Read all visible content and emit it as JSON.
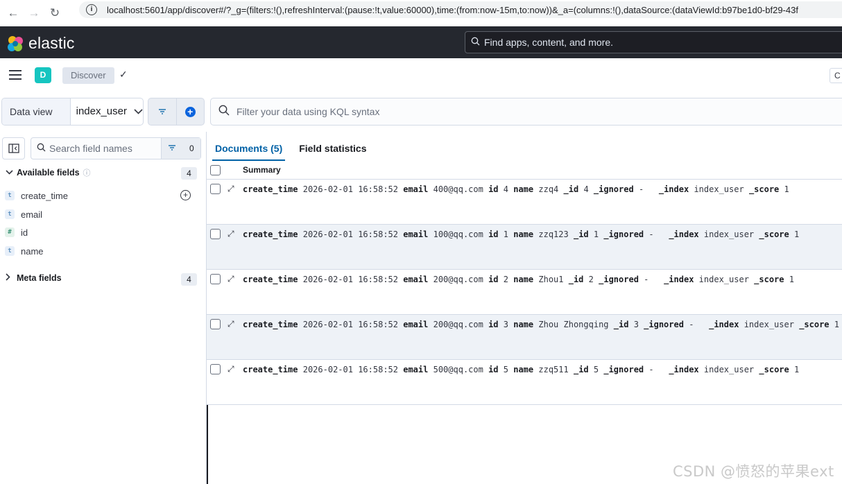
{
  "browser": {
    "url": "localhost:5601/app/discover#/?_g=(filters:!(),refreshInterval:(pause:!t,value:60000),time:(from:now-15m,to:now))&_a=(columns:!(),dataSource:(dataViewId:b97be1d0-bf29-43f"
  },
  "header": {
    "logo_text": "elastic",
    "search_placeholder": "Find apps, content, and more."
  },
  "subheader": {
    "space_initial": "D",
    "breadcrumb": "Discover",
    "right_button": "C"
  },
  "query_bar": {
    "data_view_label": "Data view",
    "data_view_value": "index_user",
    "kql_placeholder": "Filter your data using KQL syntax"
  },
  "sidebar": {
    "search_placeholder": "Search field names",
    "filter_count": "0",
    "available_title": "Available fields",
    "available_count": "4",
    "fields": [
      {
        "name": "create_time",
        "type": "t"
      },
      {
        "name": "email",
        "type": "t"
      },
      {
        "name": "id",
        "type": "#"
      },
      {
        "name": "name",
        "type": "t"
      }
    ],
    "meta_title": "Meta fields",
    "meta_count": "4"
  },
  "tabs": [
    {
      "label": "Documents (5)",
      "active": true
    },
    {
      "label": "Field statistics",
      "active": false
    }
  ],
  "grid": {
    "summary_header": "Summary",
    "rows": [
      {
        "create_time": "2026-02-01 16:58:52",
        "email": "400@qq.com",
        "id": "4",
        "name": "zzq4",
        "_id": "4",
        "_ignored": "-",
        "_index": "index_user",
        "_score": "1"
      },
      {
        "create_time": "2026-02-01 16:58:52",
        "email": "100@qq.com",
        "id": "1",
        "name": "zzq123",
        "_id": "1",
        "_ignored": "-",
        "_index": "index_user",
        "_score": "1"
      },
      {
        "create_time": "2026-02-01 16:58:52",
        "email": "200@qq.com",
        "id": "2",
        "name": "Zhou1",
        "_id": "2",
        "_ignored": "-",
        "_index": "index_user",
        "_score": "1"
      },
      {
        "create_time": "2026-02-01 16:58:52",
        "email": "200@qq.com",
        "id": "3",
        "name": "Zhou Zhongqing",
        "_id": "3",
        "_ignored": "-",
        "_index": "index_user",
        "_score": "1"
      },
      {
        "create_time": "2026-02-01 16:58:52",
        "email": "500@qq.com",
        "id": "5",
        "name": "zzq511",
        "_id": "5",
        "_ignored": "-",
        "_index": "index_user",
        "_score": "1"
      }
    ]
  },
  "watermark": "CSDN @愤怒的苹果ext",
  "colors": {
    "accent": "#0061a6",
    "header_bg": "#25282f",
    "space_avatar": "#16c5c0"
  }
}
